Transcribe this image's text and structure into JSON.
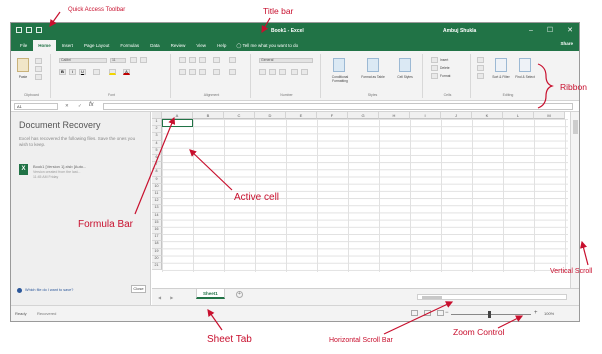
{
  "annotations": {
    "quick_access_toolbar": "Quick Access Toolbar",
    "title_bar": "Title bar",
    "ribbon": "Ribbon",
    "formula_bar": "Formula Bar",
    "active_cell": "Active cell",
    "vertical_scroll": "Vertical Scroll",
    "sheet_tab": "Sheet Tab",
    "horizontal_scroll_bar": "Horizontal Scroll Bar",
    "zoom_control": "Zoom Control"
  },
  "window": {
    "title": "Book1 - Excel",
    "user": "Ambuj Shukla",
    "controls": [
      "–",
      "☐",
      "✕"
    ]
  },
  "tabs": [
    "File",
    "Home",
    "Insert",
    "Page Layout",
    "Formulas",
    "Data",
    "Review",
    "View",
    "Help"
  ],
  "active_tab": "Home",
  "tell_me": "Tell me what you want to do",
  "share": "Share",
  "ribbon": {
    "groups": [
      "Clipboard",
      "Font",
      "Alignment",
      "Number",
      "Styles",
      "Cells",
      "Editing"
    ],
    "paste": "Paste",
    "font_name": "Calibri",
    "font_size": "11",
    "number_format": "General",
    "conditional_formatting": "Conditional Formatting",
    "format_as_table": "Format as Table",
    "cell_styles": "Cell Styles",
    "insert": "Insert",
    "delete": "Delete",
    "format": "Format",
    "sort_filter": "Sort & Filter",
    "find_select": "Find & Select"
  },
  "formula_bar": {
    "name_box": "A1",
    "fx": "fx",
    "buttons": "✕ ✓"
  },
  "recovery": {
    "title": "Document Recovery",
    "text": "Excel has recovered the following files. Save the ones you wish to keep.",
    "file_name": "Book1 [Version 1].xlsb [Auto...",
    "file_version": "Version created from the last...",
    "file_time": "11:45 AM Friday",
    "link": "Which file do I want to save?",
    "close": "Close"
  },
  "columns": [
    "A",
    "B",
    "C",
    "D",
    "E",
    "F",
    "G",
    "H",
    "I",
    "J",
    "K",
    "L",
    "M"
  ],
  "rows": [
    "1",
    "2",
    "3",
    "4",
    "5",
    "6",
    "7",
    "8",
    "9",
    "10",
    "11",
    "12",
    "13",
    "14",
    "15",
    "16",
    "17",
    "18",
    "19",
    "20",
    "21"
  ],
  "sheet": {
    "tab": "Sheet1",
    "add": "+",
    "nav": "◀ ▶"
  },
  "status": {
    "ready": "Ready",
    "recovered": "Recovered",
    "zoom_minus": "−",
    "zoom_plus": "+",
    "zoom": "100%",
    "zoom_level": 1.0
  },
  "colors": {
    "excel_green": "#217346",
    "annotation_red": "#c8102e"
  }
}
